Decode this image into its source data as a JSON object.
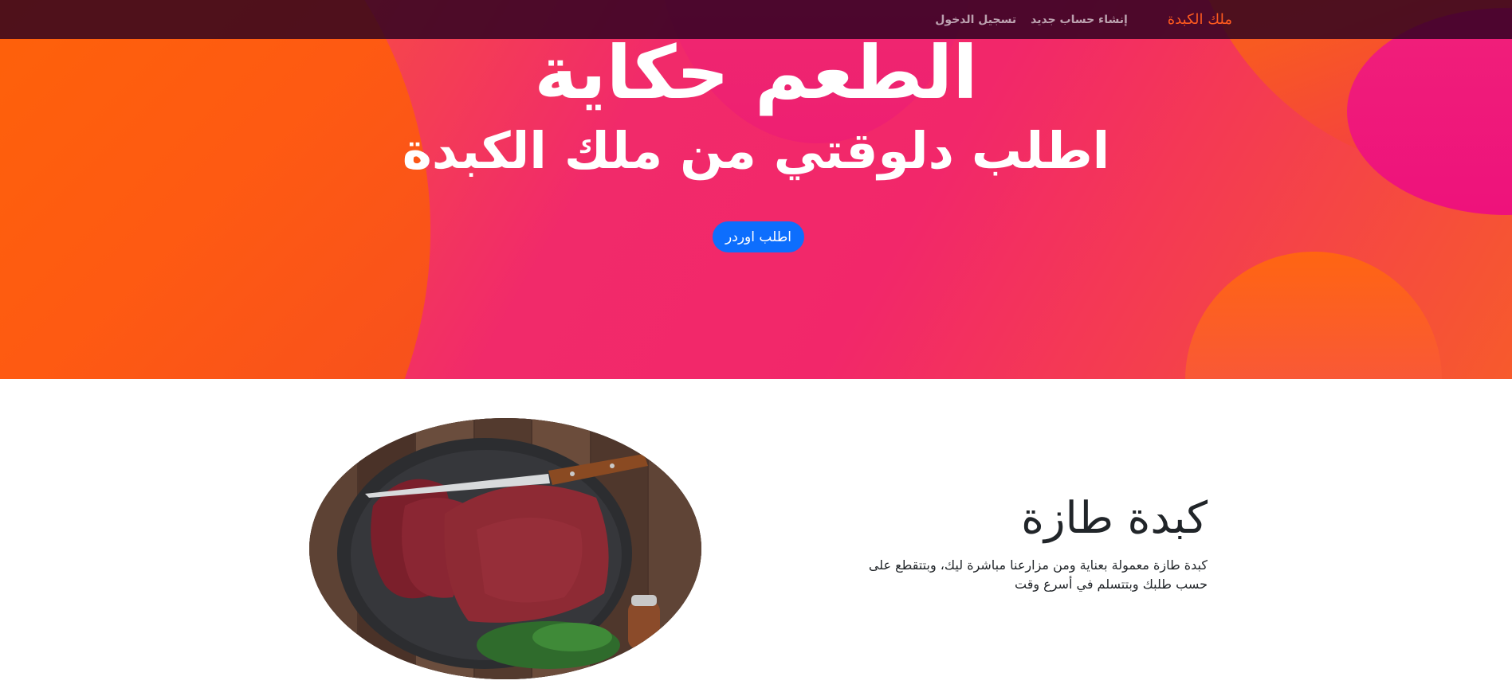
{
  "nav": {
    "brand": "ملك الكبدة",
    "links": [
      "إنشاء حساب جديد",
      "تسجيل الدخول"
    ]
  },
  "hero": {
    "title": "الطعم حكاية",
    "subtitle": "اطلب دلوقتي من ملك الكبدة",
    "cta_label": "اطلب اوردر"
  },
  "feature": {
    "heading": "كبدة طازة",
    "description": "كبدة طازة معمولة بعناية ومن مزارعنا مباشرة ليك، وبتتقطع على حسب طلبك وبتتسلم في أسرع وقت"
  },
  "colors": {
    "brand": "#ff5a1f",
    "primary_button": "#0d6efd",
    "navbar_bg": "#2a001e",
    "hero_pink": "#f12a6a",
    "hero_orange": "#fb6a24"
  }
}
